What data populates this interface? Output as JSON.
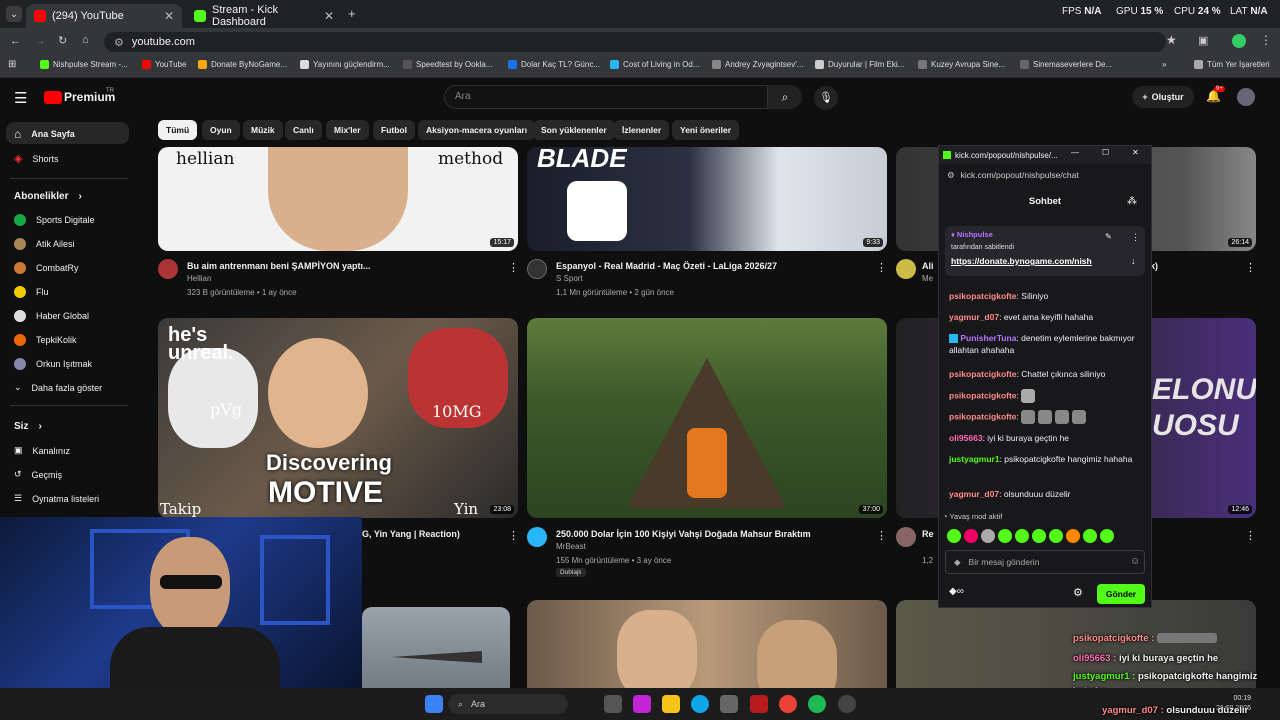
{
  "browser": {
    "tabs": [
      {
        "label": "(294) YouTube",
        "color": "#ff0000"
      },
      {
        "label": "Stream - Kick Dashboard",
        "color": "#53fc18"
      }
    ],
    "url": "youtube.com",
    "bookmarks": [
      "Nishpulse Stream -...",
      "YouTube",
      "Donate ByNoGame...",
      "Yayınını güçlendirm...",
      "Speedtest by Ookla...",
      "Dolar Kaç TL? Günc...",
      "Cost of Living in Od...",
      "Andrey Zvyagintsev'...",
      "Duyurular | Film Eki...",
      "Kuzey Avrupa Sine...",
      "Sinemaseverlere De..."
    ],
    "all_bookmarks": "Tüm Yer İşaretleri",
    "stats": {
      "fps_label": "FPS",
      "fps": "N/A",
      "gpu_label": "GPU",
      "gpu": "15 %",
      "cpu_label": "CPU",
      "cpu": "24 %",
      "lat_label": "LAT",
      "lat": "N/A"
    }
  },
  "youtube": {
    "logo": "Premium",
    "logo_sup": "TR",
    "search_placeholder": "Ara",
    "create_label": "Oluştur",
    "notif_count": "9+",
    "chips": [
      "Tümü",
      "Oyun",
      "Müzik",
      "Canlı",
      "Mix'ler",
      "Futbol",
      "Aksiyon-macera oyunları",
      "Son yüklenenler",
      "İzlenenler",
      "Yeni öneriler"
    ],
    "sidebar": {
      "home": "Ana Sayfa",
      "shorts": "Shorts",
      "subs_header": "Abonelikler",
      "subs": [
        "Sports Digitale",
        "Atik Ailesi",
        "CombatRy",
        "Flu",
        "Haber Global",
        "TepkiKolik",
        "Orkun Işıtmak"
      ],
      "show_more": "Daha fazla göster",
      "you_header": "Siz",
      "you_items": [
        "Kanalınız",
        "Geçmiş",
        "Oynatma listeleri"
      ]
    },
    "videos": [
      {
        "title": "Bu aim antrenmanı beni ŞAMPİYON yaptı...",
        "channel": "Hellian",
        "meta": "323 B görüntüleme • 1 ay önce",
        "duration": "15:17",
        "thumb_text_l": "hellian",
        "thumb_text_r": "method"
      },
      {
        "title": "Espanyol - Real Madrid - Maç Özeti - LaLiga 2026/27",
        "channel": "S Sport",
        "meta": "1,1 Mn görüntüleme • 2 gün önce",
        "duration": "9:33",
        "thumb_text": "BLADE"
      },
      {
        "duration": "26:14"
      },
      {
        "title": "G, Yin Yang | Reaction)",
        "duration": "23:08",
        "thumb_l1": "he's",
        "thumb_l2": "unreal.",
        "thumb_big1": "Discovering",
        "thumb_big2": "MOTIVE",
        "thumb_a": "pVg",
        "thumb_b": "10MG",
        "thumb_c": "Takip",
        "thumb_d": "Yin Yang"
      },
      {
        "title": "250.000 Dolar İçin 100 Kişiyi Vahşi Doğada Mahsur Bıraktım",
        "channel": "MrBeast",
        "meta": "155 Mn görüntüleme • 3 ay önce",
        "badge": "Dublajlı",
        "duration": "37:00"
      },
      {
        "duration": "12:46",
        "thumb_text": "ELONUN UOSU"
      }
    ],
    "partial": {
      "a": "Ali",
      "b": "Me",
      "c": "Re",
      "d": "1,2",
      "e": "k)"
    }
  },
  "chat": {
    "window_url": "kick.com/popout/nishpulse/...",
    "address": "kick.com/popout/nishpulse/chat",
    "title": "Sohbet",
    "pinned_user": "Nishpulse",
    "pinned_by": "tarafından sabitlendi",
    "pinned_link": "https://donate.bynogame.com/nish",
    "messages": [
      {
        "user": "psikopatcigkofte",
        "color": "#ff8a8a",
        "text": "Siliniyo"
      },
      {
        "user": "yagmur_d07",
        "color": "#ff8a8a",
        "text": "evet ama keyifli hahaha"
      },
      {
        "user": "PunisherTuna",
        "color": "#b576ff",
        "text": "denetim eylemlerine bakmıyor allahtan ahahaha"
      },
      {
        "user": "psikopatcigkofte",
        "color": "#ff8a8a",
        "text": "Chattel çıkınca siliniyo"
      },
      {
        "user": "psikopatcigkofte",
        "color": "#ff8a8a",
        "text": ""
      },
      {
        "user": "psikopatcigkofte",
        "color": "#ff8a8a",
        "text": ""
      },
      {
        "user": "oli95663",
        "color": "#ff69b4",
        "text": "iyi ki buraya geçtin he"
      },
      {
        "user": "justyagmur1",
        "color": "#53fc18",
        "text": "psikopatcigkofte hangimiz hahaha"
      },
      {
        "user": "yagmur_d07",
        "color": "#ff8a8a",
        "text": "olsunduuu düzelir"
      }
    ],
    "slow_mode": "Yavaş mod aktif",
    "input_placeholder": "Bir mesaj gönderin",
    "send_label": "Gönder"
  },
  "overlay": [
    {
      "user": "psikopatcigkofte :",
      "color": "#ff8a8a",
      "text": ""
    },
    {
      "user": "oli95663 :",
      "color": "#ff69b4",
      "text": "iyi ki buraya geçtin he"
    },
    {
      "user": "justyagmur1 :",
      "color": "#53fc18",
      "text": "psikopatcigkofte hangimiz"
    },
    {
      "user": "",
      "color": "#fff",
      "text": "hahaha"
    },
    {
      "user": "yagmur_d07 :",
      "color": "#ff8a8a",
      "text": "olsunduuu düzelir"
    }
  ],
  "taskbar": {
    "search": "Ara",
    "time": "00:19",
    "date": "26.08.2026"
  }
}
